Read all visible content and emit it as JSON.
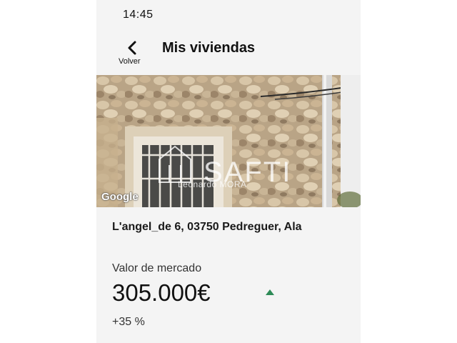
{
  "status_bar": {
    "time": "14:45"
  },
  "header": {
    "back_label": "Volver",
    "title": "Mis viviendas"
  },
  "photo": {
    "google_attribution": "Google",
    "watermark_brand": "SAFTI",
    "watermark_agent": "Leonardo MORA"
  },
  "property": {
    "address": "L'angel_de 6, 03750 Pedreguer, Ala",
    "market_value_label": "Valor de mercado",
    "market_value": "305.000€",
    "change_percent": "+35 %",
    "trend": "up"
  },
  "colors": {
    "trend_up": "#2e8b57",
    "background": "#f4f4f4"
  },
  "icons": {
    "back": "chevron-left-icon",
    "trend": "triangle-up-icon"
  }
}
